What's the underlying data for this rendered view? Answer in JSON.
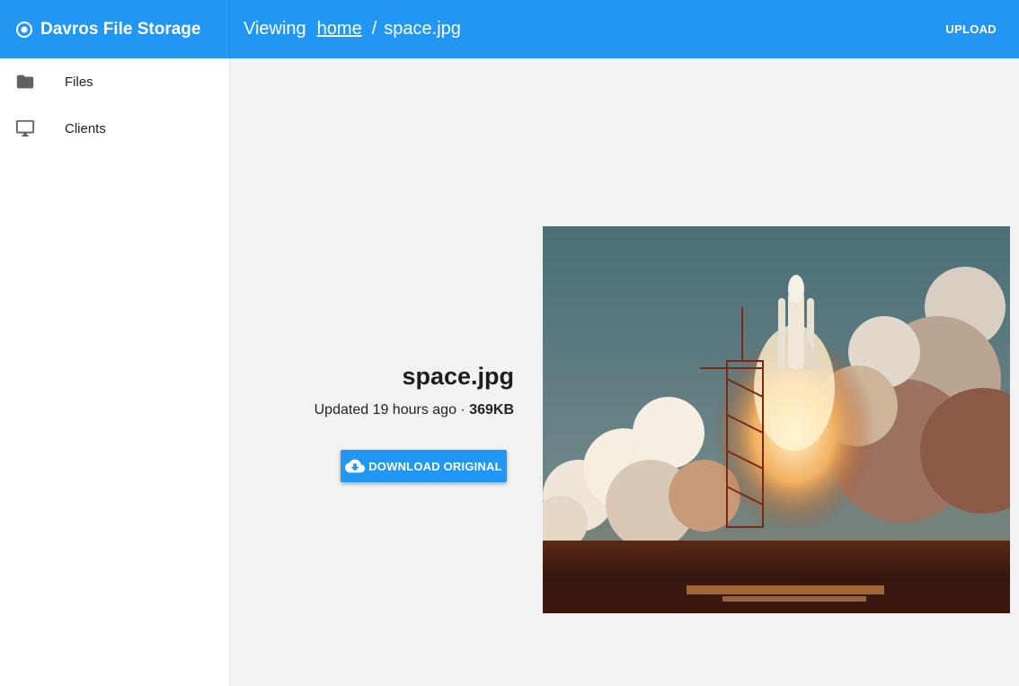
{
  "app": {
    "title": "Davros File Storage",
    "icon": "target-icon"
  },
  "header": {
    "viewing_label": "Viewing",
    "breadcrumb_link": "home",
    "breadcrumb_sep": "/",
    "breadcrumb_current": "space.jpg",
    "upload_label": "UPLOAD"
  },
  "sidebar": {
    "items": [
      {
        "label": "Files",
        "icon": "folder-icon"
      },
      {
        "label": "Clients",
        "icon": "monitor-icon"
      }
    ]
  },
  "file": {
    "name": "space.jpg",
    "updated": "Updated 19 hours ago",
    "dot": " · ",
    "size": "369KB",
    "download_label": "DOWNLOAD ORIGINAL",
    "download_icon": "cloud-download-icon"
  },
  "colors": {
    "accent": "#2196f3",
    "background": "#f2f2f2"
  }
}
